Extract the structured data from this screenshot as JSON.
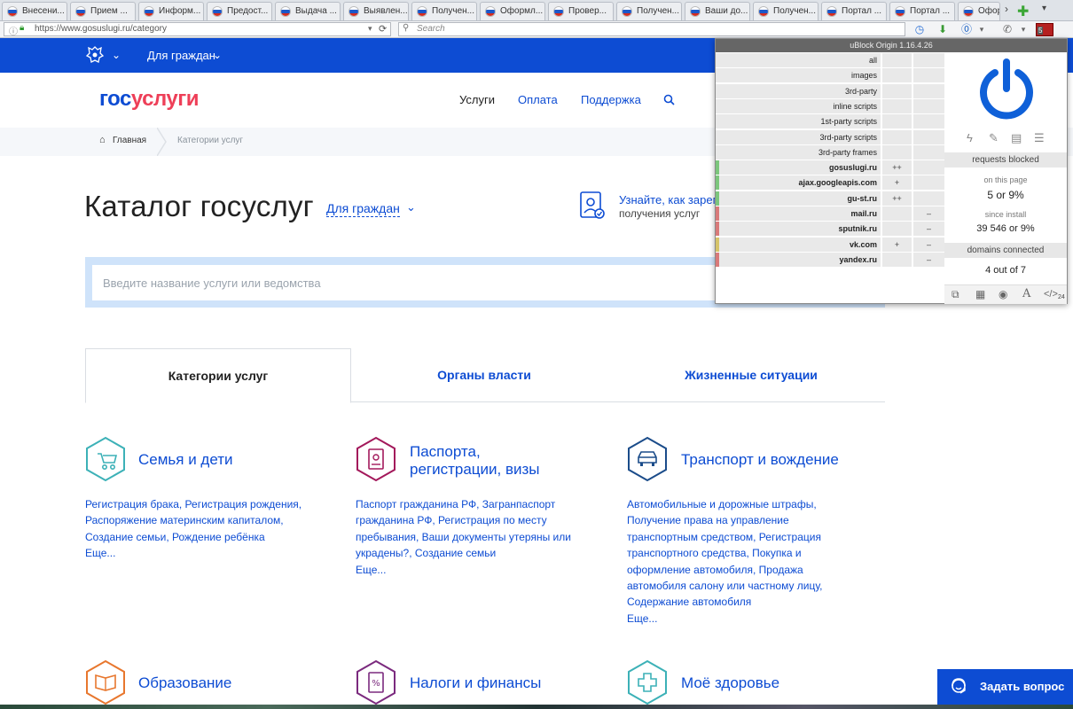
{
  "browser": {
    "tabs": [
      {
        "label": "Внесени..."
      },
      {
        "label": "Прием ..."
      },
      {
        "label": "Информ..."
      },
      {
        "label": "Предост..."
      },
      {
        "label": "Выдача ..."
      },
      {
        "label": "Выявлен..."
      },
      {
        "label": "Получен..."
      },
      {
        "label": "Оформл..."
      },
      {
        "label": "Провер..."
      },
      {
        "label": "Получен..."
      },
      {
        "label": "Ваши до..."
      },
      {
        "label": "Получен..."
      },
      {
        "label": "Портал ..."
      },
      {
        "label": "Портал ..."
      },
      {
        "label": "Офор"
      }
    ],
    "url": "https://www.gosuslugi.ru/category",
    "search_placeholder": "Search",
    "ublock_badge": "5"
  },
  "site": {
    "audience_label": "Для граждан",
    "logo_part1": "гос",
    "logo_part2": "услуги",
    "nav": [
      "Услуги",
      "Оплата",
      "Поддержка"
    ],
    "breadcrumb": {
      "home": "Главная",
      "current": "Категории услуг"
    },
    "catalog_title": "Каталог госуслуг",
    "audience_select": "Для граждан",
    "promo_line1": "Узнайте, как зарегис",
    "promo_line2": "получения услуг",
    "search_placeholder": "Введите название услуги или ведомства",
    "tabs": [
      "Категории услуг",
      "Органы власти",
      "Жизненные ситуации"
    ],
    "categories": [
      {
        "title": "Семья и дети",
        "links": [
          "Регистрация брака, Регистрация рождения,",
          "Распоряжение материнским капиталом,",
          "Создание семьи, Рождение ребёнка",
          "Еще..."
        ]
      },
      {
        "title_line1": "Паспорта,",
        "title_line2": "регистрации, визы",
        "links": [
          "Паспорт гражданина РФ, Загранпаспорт",
          "гражданина РФ, Регистрация по месту",
          "пребывания, Ваши документы утеряны или",
          "украдены?, Создание семьи",
          "Еще..."
        ]
      },
      {
        "title": "Транспорт и вождение",
        "links": [
          "Автомобильные и дорожные штрафы,",
          "Получение права на управление",
          "транспортным средством, Регистрация",
          "транспортного средства, Покупка и",
          "оформление автомобиля, Продажа",
          "автомобиля салону или частному лицу,",
          "Содержание автомобиля",
          "Еще..."
        ]
      },
      {
        "title": "Образование"
      },
      {
        "title": "Налоги и финансы"
      },
      {
        "title": "Моё здоровье"
      }
    ],
    "ask_button": "Задать вопрос"
  },
  "ublock": {
    "title": "uBlock Origin 1.16.4.26",
    "rows": [
      {
        "name": "all",
        "c1": "",
        "c2": "",
        "bar": ""
      },
      {
        "name": "images",
        "c1": "",
        "c2": "",
        "bar": ""
      },
      {
        "name": "3rd-party",
        "c1": "",
        "c2": "",
        "bar": ""
      },
      {
        "name": "inline scripts",
        "c1": "",
        "c2": "",
        "bar": ""
      },
      {
        "name": "1st-party scripts",
        "c1": "",
        "c2": "",
        "bar": ""
      },
      {
        "name": "3rd-party scripts",
        "c1": "",
        "c2": "",
        "bar": ""
      },
      {
        "name": "3rd-party frames",
        "c1": "",
        "c2": "",
        "bar": ""
      },
      {
        "name": "gosuslugi.ru",
        "c1": "++",
        "c2": "",
        "bar": "#7cc67c"
      },
      {
        "name": "ajax.googleapis.com",
        "c1": "+",
        "c2": "",
        "bar": "#7cc67c"
      },
      {
        "name": "gu-st.ru",
        "c1": "++",
        "c2": "",
        "bar": "#7cc67c"
      },
      {
        "name": "mail.ru",
        "c1": "",
        "c2": "–",
        "bar": "#d97a7a"
      },
      {
        "name": "sputnik.ru",
        "c1": "",
        "c2": "–",
        "bar": "#d97a7a"
      },
      {
        "name": "vk.com",
        "c1": "+",
        "c2": "–",
        "bar": "#d6c46a"
      },
      {
        "name": "yandex.ru",
        "c1": "",
        "c2": "–",
        "bar": "#d97a7a"
      }
    ],
    "requests_blocked": "requests blocked",
    "on_this_page_label": "on this page",
    "on_this_page_value": "5 or 9%",
    "since_install_label": "since install",
    "since_install_value": "39 546 or 9%",
    "domains_connected": "domains connected",
    "domains_value": "4 out of 7",
    "code_count": "24"
  },
  "colors": {
    "brand_blue": "#0d4cd3",
    "brand_red": "#ee3f58",
    "ublock_blue": "#0f60d8"
  }
}
